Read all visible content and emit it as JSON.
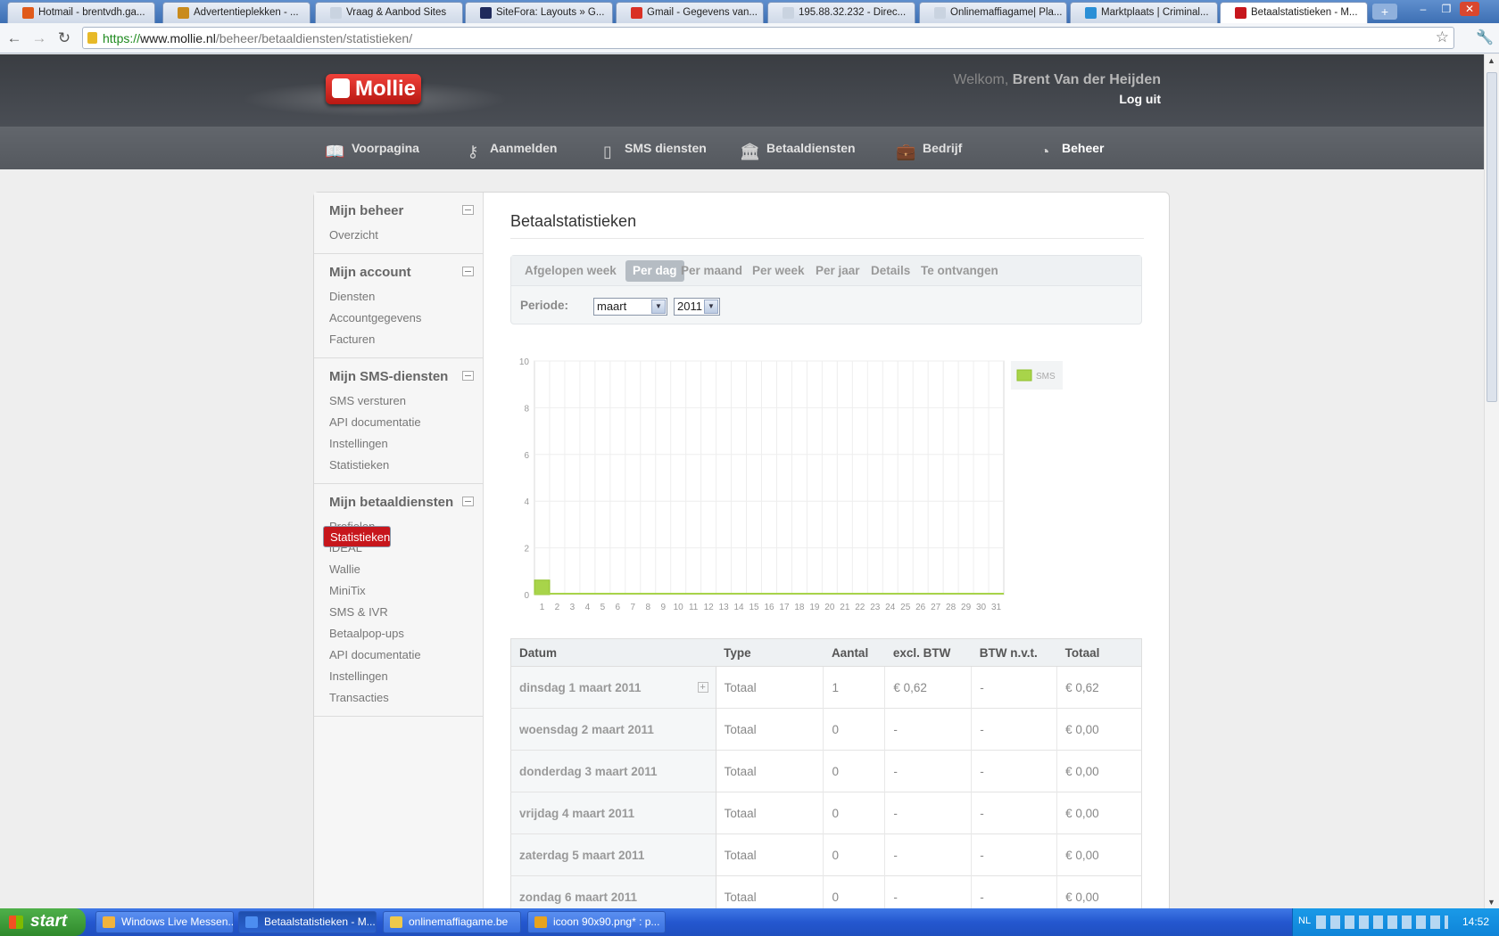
{
  "browser": {
    "tabs": [
      {
        "title": "Hotmail - brentvdh.ga...",
        "color": "#e05a1a",
        "active": false
      },
      {
        "title": "Advertentieplekken - ...",
        "color": "#c98b1c",
        "active": false
      },
      {
        "title": "Vraag & Aanbod Sites",
        "color": "#c9d3e0",
        "active": false
      },
      {
        "title": "SiteFora: Layouts » G...",
        "color": "#1f2a5c",
        "active": false
      },
      {
        "title": "Gmail - Gegevens van...",
        "color": "#d93025",
        "active": false
      },
      {
        "title": "195.88.32.232 - Direc...",
        "color": "#c9d3e0",
        "active": false
      },
      {
        "title": "Onlinemaffiagame| Pla...",
        "color": "#c9d3e0",
        "active": false
      },
      {
        "title": "Marktplaats | Criminal...",
        "color": "#2a8fd6",
        "active": false
      },
      {
        "title": "Betaalstatistieken - M...",
        "color": "#c7161c",
        "active": true
      }
    ],
    "new_tab": "+",
    "url_scheme": "https://",
    "url_host": "www.mollie.nl",
    "url_path": "/beheer/betaaldiensten/statistieken/"
  },
  "header": {
    "logo_text": "Mollie",
    "welcome_prefix": "Welkom, ",
    "user_name": "Brent Van der Heijden",
    "logout": "Log uit"
  },
  "mainnav": [
    {
      "label": "Voorpagina",
      "icon": "book-icon",
      "glyph": "📖"
    },
    {
      "label": "Aanmelden",
      "icon": "key-icon",
      "glyph": "⚷"
    },
    {
      "label": "SMS diensten",
      "icon": "phone-icon",
      "glyph": "▯"
    },
    {
      "label": "Betaaldiensten",
      "icon": "bank-icon",
      "glyph": "🏛"
    },
    {
      "label": "Bedrijf",
      "icon": "briefcase-icon",
      "glyph": "💼"
    },
    {
      "label": "Beheer",
      "icon": "pie-icon",
      "glyph": "◔"
    }
  ],
  "sidebar": {
    "sections": [
      {
        "title": "Mijn beheer",
        "items": [
          "Overzicht"
        ]
      },
      {
        "title": "Mijn account",
        "items": [
          "Diensten",
          "Accountgegevens",
          "Facturen"
        ]
      },
      {
        "title": "Mijn SMS-diensten",
        "items": [
          "SMS versturen",
          "API documentatie",
          "Instellingen",
          "Statistieken"
        ]
      },
      {
        "title": "Mijn betaaldiensten",
        "items": [
          "Profielen",
          "iDEAL",
          "Wallie",
          "MiniTix",
          "SMS & IVR",
          "Betaalpop-ups",
          "API documentatie",
          "Instellingen",
          "Statistieken",
          "Transacties"
        ]
      }
    ],
    "selected": "Statistieken"
  },
  "main": {
    "title": "Betaalstatistieken",
    "filter_tabs": [
      "Afgelopen week",
      "Per dag",
      "Per maand",
      "Per week",
      "Per jaar",
      "Details",
      "Te ontvangen"
    ],
    "active_tab": "Per dag",
    "periode_label": "Periode:",
    "month_value": "maart",
    "year_value": "2011"
  },
  "chart_data": {
    "type": "bar",
    "categories": [
      "1",
      "2",
      "3",
      "4",
      "5",
      "6",
      "7",
      "8",
      "9",
      "10",
      "11",
      "12",
      "13",
      "14",
      "15",
      "16",
      "17",
      "18",
      "19",
      "20",
      "21",
      "22",
      "23",
      "24",
      "25",
      "26",
      "27",
      "28",
      "29",
      "30",
      "31"
    ],
    "series": [
      {
        "name": "SMS",
        "values": [
          0.62,
          0,
          0,
          0,
          0,
          0,
          0,
          0,
          0,
          0,
          0,
          0,
          0,
          0,
          0,
          0,
          0,
          0,
          0,
          0,
          0,
          0,
          0,
          0,
          0,
          0,
          0,
          0,
          0,
          0,
          0
        ]
      }
    ],
    "yticks": [
      0,
      2,
      4,
      6,
      8,
      10
    ],
    "ylim": [
      0,
      10
    ],
    "grid": true,
    "legend": "top-right",
    "color": "#a8d44a"
  },
  "table": {
    "headers": [
      "Datum",
      "Type",
      "Aantal",
      "excl. BTW",
      "BTW n.v.t.",
      "Totaal"
    ],
    "rows": [
      [
        "dinsdag 1 maart 2011",
        "Totaal",
        "1",
        "€ 0,62",
        "-",
        "€ 0,62"
      ],
      [
        "woensdag 2 maart 2011",
        "Totaal",
        "0",
        "-",
        "-",
        "€ 0,00"
      ],
      [
        "donderdag 3 maart 2011",
        "Totaal",
        "0",
        "-",
        "-",
        "€ 0,00"
      ],
      [
        "vrijdag 4 maart 2011",
        "Totaal",
        "0",
        "-",
        "-",
        "€ 0,00"
      ],
      [
        "zaterdag 5 maart 2011",
        "Totaal",
        "0",
        "-",
        "-",
        "€ 0,00"
      ],
      [
        "zondag 6 maart 2011",
        "Totaal",
        "0",
        "-",
        "-",
        "€ 0,00"
      ]
    ]
  },
  "taskbar": {
    "start": "start",
    "tasks": [
      {
        "label": "Windows Live Messen...",
        "color": "#f2b33d"
      },
      {
        "label": "Betaalstatistieken - M...",
        "color": "#4c8df0"
      },
      {
        "label": "onlinemaffiagame.be",
        "color": "#f0c94a"
      },
      {
        "label": "icoon 90x90.png* : p...",
        "color": "#e8a31e"
      }
    ],
    "lang": "NL",
    "clock": "14:52"
  }
}
